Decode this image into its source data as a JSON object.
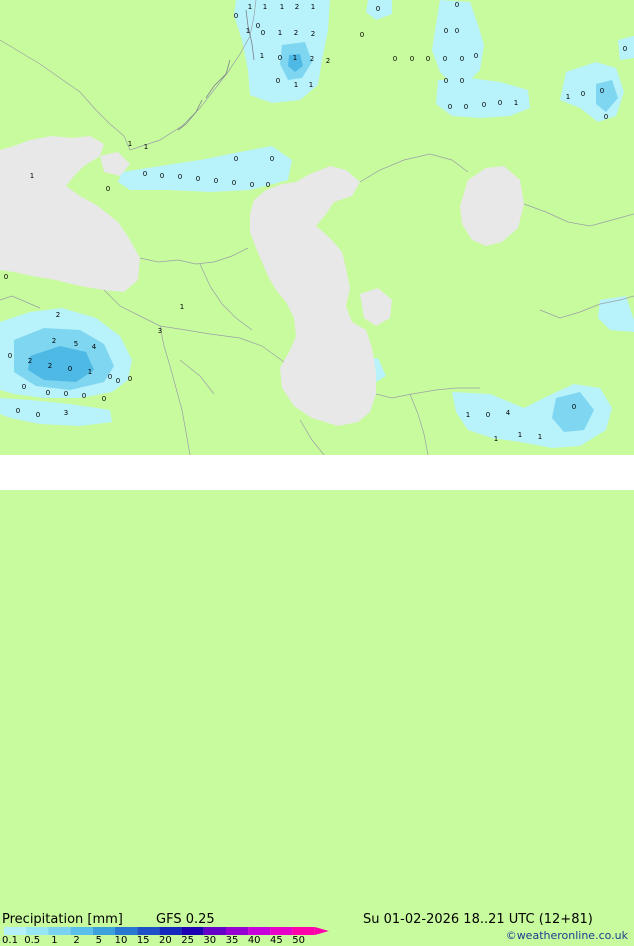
{
  "footer": {
    "title": "Precipitation [mm]",
    "model": "GFS 0.25",
    "datetime": "Su 01-02-2026 18..21 UTC (12+81)",
    "credit": "©weatheronline.co.uk"
  },
  "legend": {
    "ticks": [
      "0.1",
      "0.5",
      "1",
      "2",
      "5",
      "10",
      "15",
      "20",
      "25",
      "30",
      "35",
      "40",
      "45",
      "50"
    ],
    "colors": [
      "#b4f0fa",
      "#96e6f5",
      "#78d2f0",
      "#5abeeb",
      "#3ca0dc",
      "#2878d2",
      "#1e50c8",
      "#1428be",
      "#1e00b4",
      "#6400c8",
      "#9600d2",
      "#c800dc",
      "#e600c8",
      "#ff00aa"
    ]
  },
  "colors": {
    "land": "#c8fb9d",
    "water": "#e8e8e8",
    "precip_light": "#b8f2fb",
    "precip_mid": "#7fd6f1",
    "precip_heavy": "#4fb9e6"
  },
  "map_labels": {
    "values": [
      "1",
      "1",
      "1",
      "2",
      "1",
      "0",
      "0",
      "1",
      "0",
      "1",
      "2",
      "2",
      "1",
      "0",
      "1",
      "2",
      "2",
      "0",
      "1",
      "1",
      "0",
      "0",
      "0",
      "0",
      "0",
      "0",
      "0",
      "0",
      "0",
      "0",
      "0",
      "0",
      "0",
      "0",
      "0",
      "0",
      "0",
      "1",
      "1",
      "0",
      "0",
      "0",
      "0",
      "1",
      "1",
      "1",
      "0",
      "0",
      "0",
      "0",
      "0",
      "0",
      "0",
      "0",
      "0",
      "0",
      "0",
      "1",
      "3",
      "2",
      "2",
      "5",
      "4",
      "2",
      "2",
      "0",
      "1",
      "0",
      "0",
      "0",
      "0",
      "0",
      "0",
      "0",
      "0",
      "0",
      "0",
      "0",
      "0",
      "3",
      "1",
      "0",
      "4",
      "0",
      "1",
      "1",
      "1"
    ]
  }
}
